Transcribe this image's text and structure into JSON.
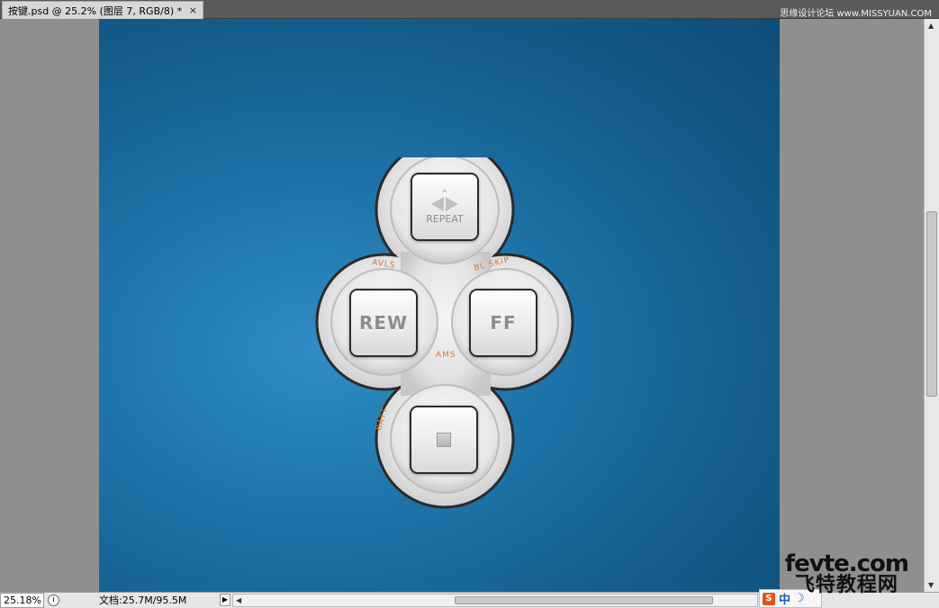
{
  "tab": {
    "title": "按键.psd @ 25.2% (图层 7, RGB/8) *",
    "close": "×"
  },
  "watermark_top": "思缘设计论坛 www.MISSYUAN.COM",
  "remote": {
    "buttons": {
      "repeat": "REPEAT",
      "rew": "REW",
      "ff": "FF"
    },
    "labels": {
      "avls": "AVLS",
      "bl_skip": "BL SKIP",
      "ams": "AMS",
      "batt": "BATT"
    }
  },
  "status": {
    "zoom": "25.18%",
    "doc_info": "文档:25.7M/95.5M"
  },
  "watermark_bottom": {
    "en": "fevte.com",
    "cn": "飞特教程网"
  },
  "ime": {
    "s": "S",
    "zh": "中"
  },
  "colors": {
    "canvas_center": "#2f8dc4",
    "canvas_edge": "#0e4d78",
    "accent_label": "#d8752f"
  }
}
